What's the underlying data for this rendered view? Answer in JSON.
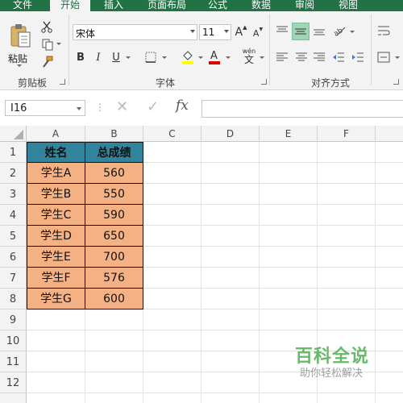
{
  "ribbon": {
    "tabs": [
      {
        "label": "文件",
        "active": false
      },
      {
        "label": "开始",
        "active": true
      },
      {
        "label": "插入",
        "active": false
      },
      {
        "label": "页面布局",
        "active": false
      },
      {
        "label": "公式",
        "active": false
      },
      {
        "label": "数据",
        "active": false
      },
      {
        "label": "审阅",
        "active": false
      },
      {
        "label": "视图",
        "active": false
      }
    ],
    "clipboard": {
      "paste_label": "粘贴",
      "group_label": "剪贴板"
    },
    "font": {
      "name": "宋体",
      "size": "11",
      "grow_label": "A",
      "shrink_label": "A",
      "bold_label": "B",
      "italic_label": "I",
      "underline_label": "U",
      "fill_label": "",
      "color_label": "A",
      "phonetic_label": "wén",
      "group_label": "字体"
    },
    "alignment": {
      "group_label": "对齐方式"
    },
    "colors": {
      "accent": "#217346",
      "fill": "#FFFF00",
      "font_color": "#E00000"
    }
  },
  "formula_bar": {
    "name_box": "I16",
    "cancel_icon": "✕",
    "enter_icon": "✓",
    "fx_label": "fx",
    "formula": ""
  },
  "sheet": {
    "columns": [
      "A",
      "B",
      "C",
      "D",
      "E",
      "F"
    ],
    "rows": [
      "1",
      "2",
      "3",
      "4",
      "5",
      "6",
      "7",
      "8",
      "9",
      "10",
      "11",
      "12"
    ],
    "header": [
      "姓名",
      "总成绩"
    ],
    "data": [
      [
        "学生A",
        "560"
      ],
      [
        "学生B",
        "550"
      ],
      [
        "学生C",
        "590"
      ],
      [
        "学生D",
        "650"
      ],
      [
        "学生E",
        "700"
      ],
      [
        "学生F",
        "576"
      ],
      [
        "学生G",
        "600"
      ]
    ],
    "header_color": "#31849B",
    "data_color": "#F4B183"
  },
  "watermark": {
    "title": "百科全说",
    "subtitle": "助你轻松解决"
  }
}
